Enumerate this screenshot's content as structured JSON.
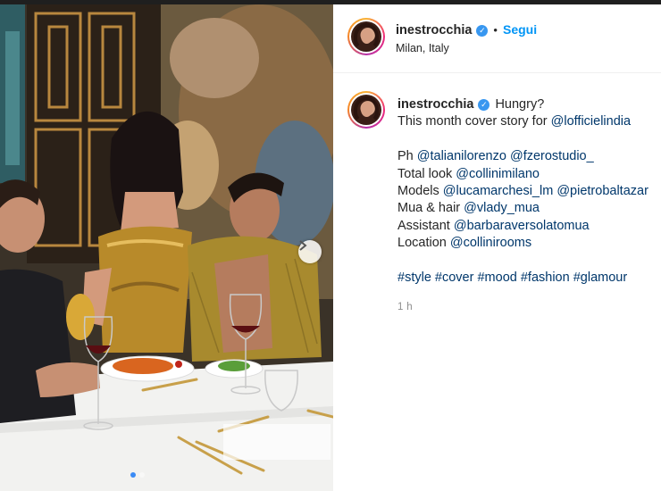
{
  "post": {
    "author": "inestrocchia",
    "follow_label": "Segui",
    "bullet": "•",
    "location": "Milan, Italy",
    "verified_icon": "verified-badge-icon",
    "timestamp": "1 h",
    "carousel": {
      "slides": 2,
      "active": 1
    }
  },
  "caption": {
    "author": "inestrocchia",
    "line1": "Hungry?",
    "line2_prefix": "This month cover story for ",
    "line2_mention": "@lofficielindia",
    "credits": [
      {
        "label": "Ph ",
        "mentions": [
          "@talianilorenzo",
          "@fzerostudio_"
        ]
      },
      {
        "label": "Total look ",
        "mentions": [
          "@collinimilano"
        ]
      },
      {
        "label": "Models ",
        "mentions": [
          "@lucamarchesi_lm",
          "@pietrobaltazar"
        ]
      },
      {
        "label": "Mua & hair ",
        "mentions": [
          "@vlady_mua"
        ]
      },
      {
        "label": "Assistant ",
        "mentions": [
          "@barbaraversolatomua"
        ]
      },
      {
        "label": "Location ",
        "mentions": [
          "@collinirooms"
        ]
      }
    ],
    "hashtags": [
      "#style",
      "#cover",
      "#mood",
      "#fashion",
      "#glamour"
    ]
  },
  "colors": {
    "link": "#00376b",
    "follow": "#0095f6",
    "verified": "#3897f0",
    "muted": "#8e8e8e"
  }
}
